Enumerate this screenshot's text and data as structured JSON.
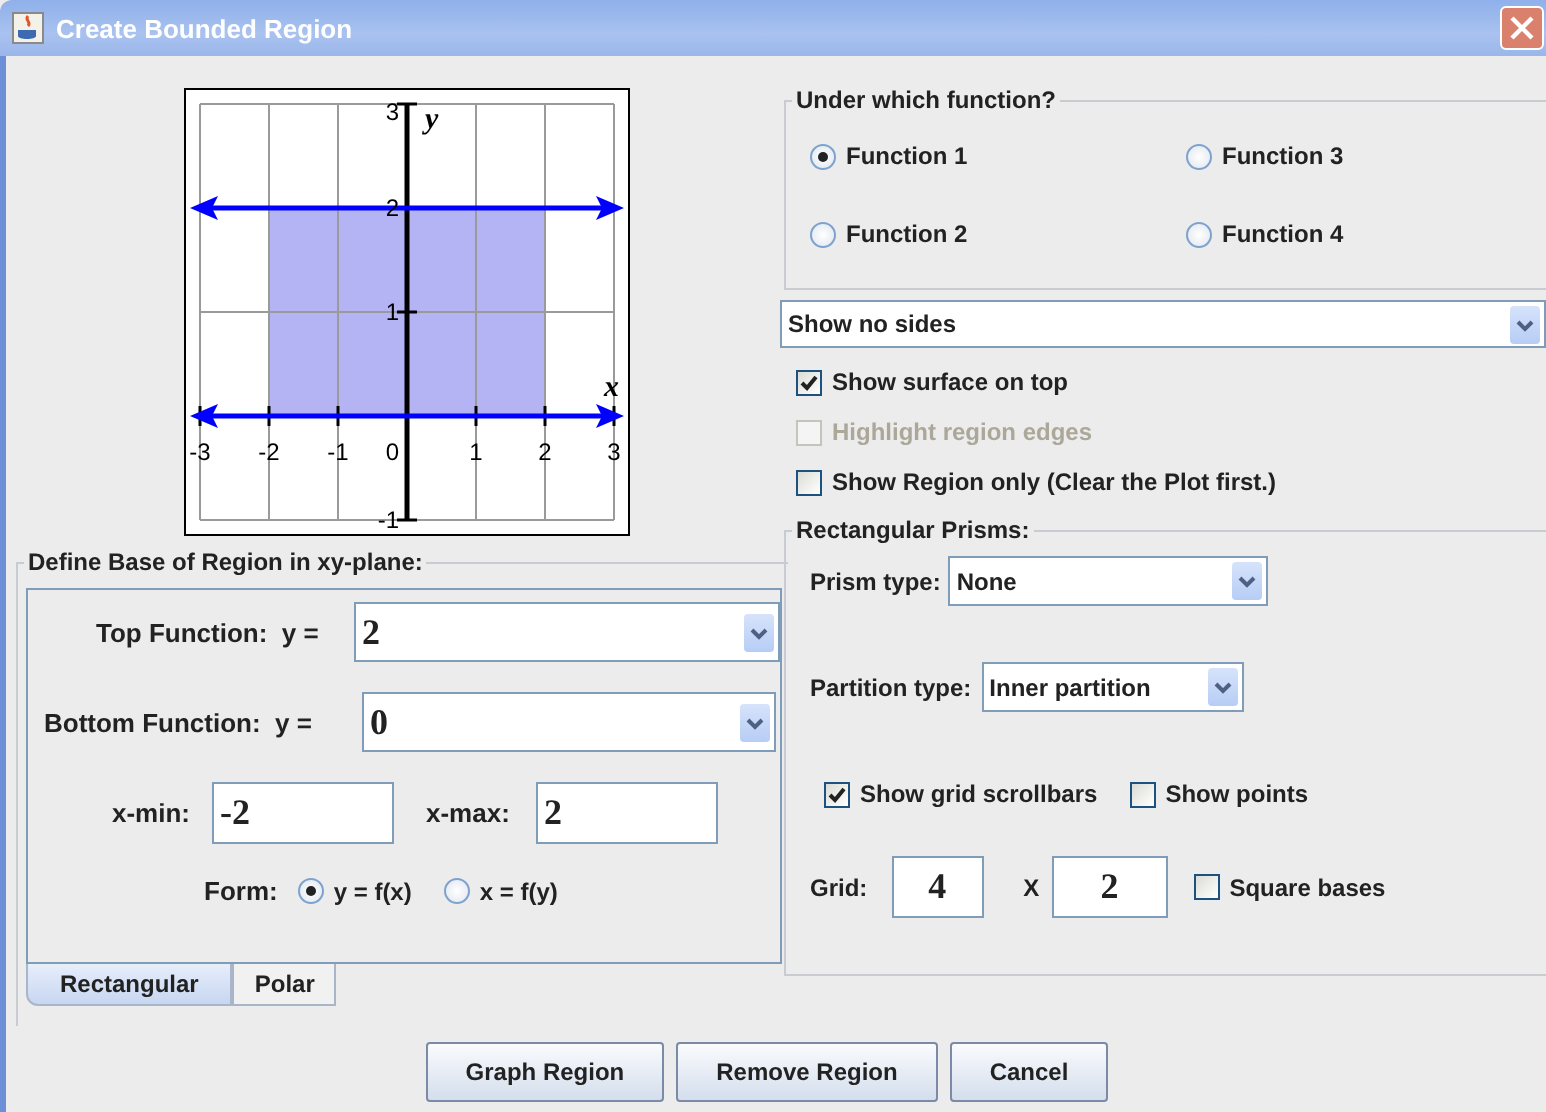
{
  "window": {
    "title": "Create Bounded Region"
  },
  "graph": {
    "chart_data": {
      "type": "line",
      "xlabel": "x",
      "ylabel": "y",
      "xlim": [
        -3,
        3
      ],
      "ylim": [
        -1,
        3
      ],
      "xticks": [
        -3,
        -2,
        -1,
        0,
        1,
        2,
        3
      ],
      "yticks": [
        -1,
        1,
        2,
        3
      ],
      "x": [
        -3,
        3
      ],
      "grid": true,
      "series": [
        {
          "color": "#0000ff",
          "values": [
            2,
            2
          ]
        },
        {
          "color": "#0000ff",
          "values": [
            0,
            0
          ]
        }
      ]
    }
  },
  "base_region": {
    "title": "Define Base of Region in xy-plane:",
    "top_function": {
      "label": "Top Function:",
      "prefix": "y =",
      "value": "2"
    },
    "bottom_function": {
      "label": "Bottom Function:",
      "prefix": "y =",
      "value": "0"
    },
    "x_min": {
      "label": "x-min:",
      "value": "-2"
    },
    "x_max": {
      "label": "x-max:",
      "value": "2"
    },
    "form": {
      "label": "Form:",
      "options": [
        {
          "label": "y = f(x)",
          "selected": true
        },
        {
          "label": "x = f(y)",
          "selected": false
        }
      ]
    },
    "tabs": [
      {
        "label": "Rectangular",
        "selected": true
      },
      {
        "label": "Polar",
        "selected": false
      }
    ]
  },
  "function_choice": {
    "title": "Under which function?",
    "options": [
      {
        "label": "Function 1",
        "selected": true
      },
      {
        "label": "Function 3",
        "selected": false
      },
      {
        "label": "Function 2",
        "selected": false
      },
      {
        "label": "Function 4",
        "selected": false
      }
    ]
  },
  "sides_dropdown": {
    "value": "Show no sides"
  },
  "options": [
    {
      "label": "Show surface on top",
      "checked": true,
      "disabled": false
    },
    {
      "label": "Highlight region edges",
      "checked": false,
      "disabled": true
    },
    {
      "label": "Show Region only (Clear the Plot first.)",
      "checked": false,
      "disabled": false
    }
  ],
  "prisms": {
    "title": "Rectangular Prisms:",
    "prism_type": {
      "label": "Prism type:",
      "value": "None"
    },
    "partition_type": {
      "label": "Partition type:",
      "value": "Inner partition"
    },
    "checkboxes": [
      {
        "label": "Show grid scrollbars",
        "checked": true
      },
      {
        "label": "Show points",
        "checked": false
      }
    ],
    "grid": {
      "label": "Grid:",
      "rows": "4",
      "separator": "X",
      "columns": "2"
    },
    "square_bases": {
      "label": "Square bases",
      "checked": false
    }
  },
  "buttons": [
    "Graph Region",
    "Remove Region",
    "Cancel"
  ]
}
